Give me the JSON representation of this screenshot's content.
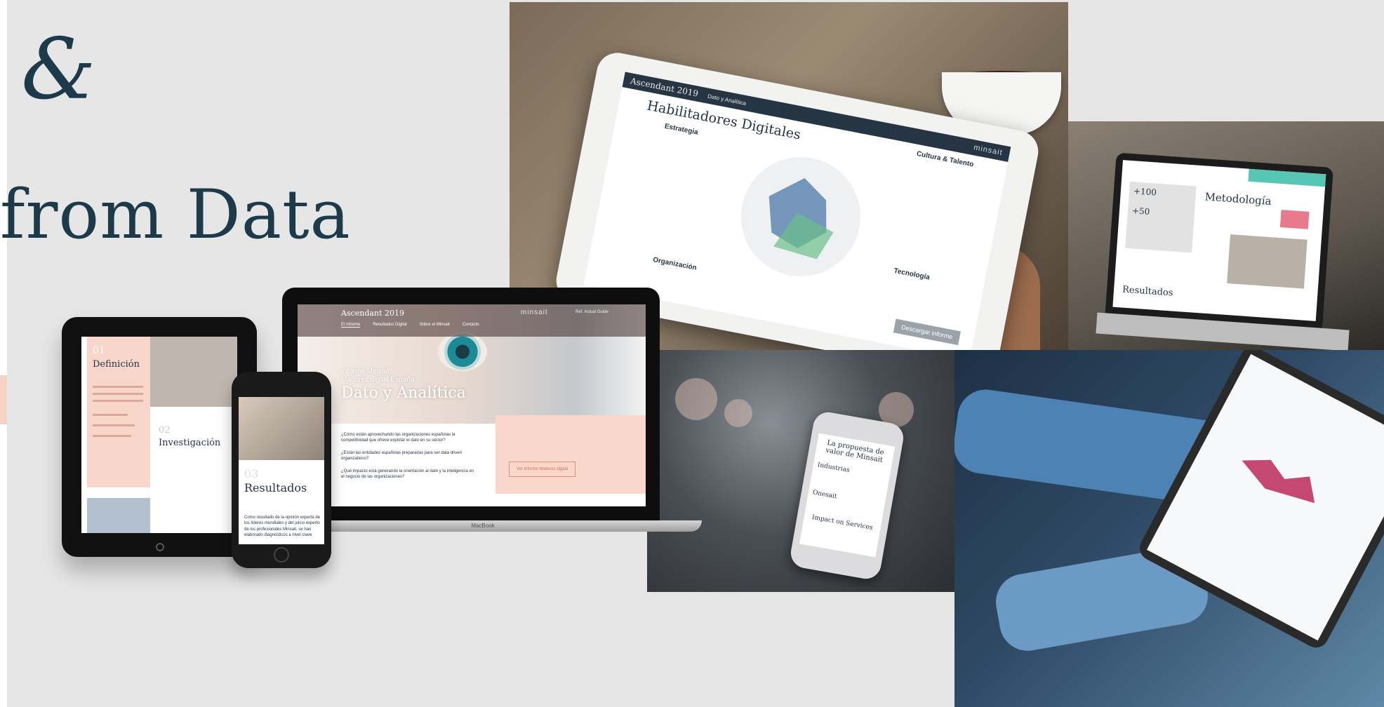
{
  "hero": {
    "ampersand": "&",
    "headline": "from Data"
  },
  "colors": {
    "background": "#e6e6e6",
    "headline": "#1d3a4a",
    "accent_peach": "#f8d6c9",
    "navy": "#263544"
  },
  "cafe_tablet": {
    "brand": "Ascendant 2019",
    "section": "Dato y Analítica",
    "logo": "minsait",
    "title": "Habilitadores Digitales",
    "labels": [
      "Estrategia",
      "Cultura & Talento",
      "Tecnología",
      "Organización"
    ],
    "download_button": "Descargar informe"
  },
  "cafe_laptop": {
    "stat_1": "+100",
    "stat_2": "+50",
    "heading": "Metodología",
    "footer_heading": "Resultados"
  },
  "phone_in_hand": {
    "title": "La propuesta de valor de Minsait",
    "item_1": "Industrias",
    "item_2": "Onesait",
    "item_3": "Impact on Services"
  },
  "ipad_mockup": {
    "num_1": "01",
    "heading_1": "Definición",
    "num_2": "02",
    "heading_2": "Investigación"
  },
  "macbook_mockup": {
    "brand": "Ascendant 2019",
    "logo": "minsait",
    "extra_link": "Ref. Actual Guide",
    "menu": [
      "El Informe",
      "Resultados Digital",
      "Sobre el Minsait",
      "Contacto"
    ],
    "kicker_1": "Informe Minsait",
    "kicker_2": "Madurez digital España",
    "title": "Dato y Analítica",
    "questions": [
      "¿Cómo están aprovechando las organizaciones españolas la competitividad que ofrece explotar el dato en su sector?",
      "¿Están las entidades españolas preparadas para ser data driven organizations?",
      "¿Qué impacto está generando la orientación al dato y la inteligencia en el negocio de las organizaciones?"
    ],
    "cta": "Ver informe Madurez digital",
    "base_label": "MacBook"
  },
  "iphone_mockup": {
    "num": "03",
    "heading": "Resultados",
    "body": "Como resultado de la opinión experta de los líderes mundiales y del juicio experto de los profesionales Minsait, se han elaborado diagnósticos a nivel clave"
  }
}
